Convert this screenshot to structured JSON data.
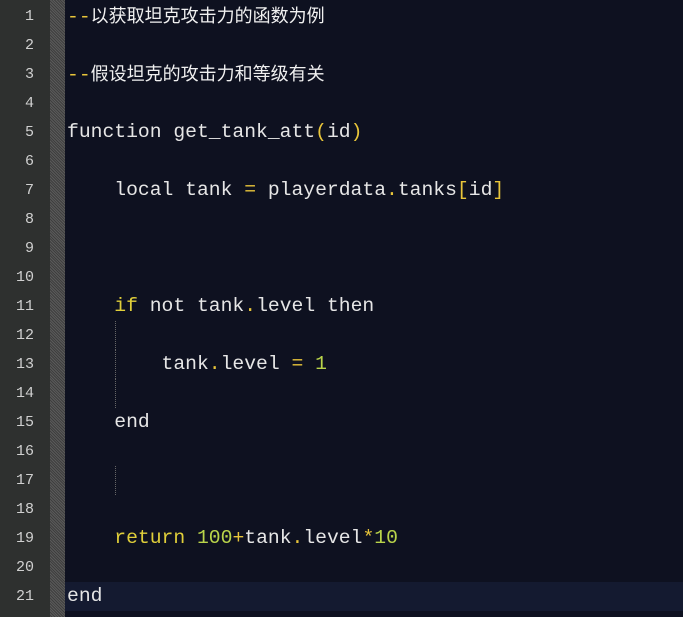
{
  "editor": {
    "colors": {
      "background": "#0e1120",
      "gutter": "#2e302f",
      "comment": "#e8c53a",
      "keyword": "#e0cf3a",
      "number": "#b9d44a",
      "current_line": "#141a30"
    },
    "current_line": 21,
    "lines": [
      {
        "n": "1",
        "tokens": [
          [
            "comment",
            "--"
          ],
          [
            "cjk",
            "以获取坦克攻击力的函数为例"
          ]
        ]
      },
      {
        "n": "2",
        "tokens": []
      },
      {
        "n": "3",
        "tokens": [
          [
            "comment",
            "--"
          ],
          [
            "cjk",
            "假设坦克的攻击力和等级有关"
          ]
        ]
      },
      {
        "n": "4",
        "tokens": []
      },
      {
        "n": "5",
        "tokens": [
          [
            "plain",
            "function get_tank_att"
          ],
          [
            "punc",
            "("
          ],
          [
            "plain",
            "id"
          ],
          [
            "punc",
            ")"
          ]
        ]
      },
      {
        "n": "6",
        "tokens": []
      },
      {
        "n": "7",
        "tokens": [
          [
            "plain",
            "    local tank "
          ],
          [
            "punc",
            "="
          ],
          [
            "plain",
            " playerdata"
          ],
          [
            "punc",
            "."
          ],
          [
            "plain",
            "tanks"
          ],
          [
            "punc",
            "["
          ],
          [
            "plain",
            "id"
          ],
          [
            "punc",
            "]"
          ]
        ]
      },
      {
        "n": "8",
        "tokens": []
      },
      {
        "n": "9",
        "tokens": []
      },
      {
        "n": "10",
        "tokens": []
      },
      {
        "n": "11",
        "tokens": [
          [
            "plain",
            "    "
          ],
          [
            "kw",
            "if"
          ],
          [
            "plain",
            " not tank"
          ],
          [
            "punc",
            "."
          ],
          [
            "plain",
            "level then"
          ]
        ]
      },
      {
        "n": "12",
        "tokens": [],
        "guide": true
      },
      {
        "n": "13",
        "tokens": [
          [
            "plain",
            "        tank"
          ],
          [
            "punc",
            "."
          ],
          [
            "plain",
            "level "
          ],
          [
            "punc",
            "="
          ],
          [
            "plain",
            " "
          ],
          [
            "num",
            "1"
          ]
        ],
        "guide": true
      },
      {
        "n": "14",
        "tokens": [],
        "guide": true
      },
      {
        "n": "15",
        "tokens": [
          [
            "plain",
            "    end"
          ]
        ]
      },
      {
        "n": "16",
        "tokens": []
      },
      {
        "n": "17",
        "tokens": [],
        "guide": true
      },
      {
        "n": "18",
        "tokens": []
      },
      {
        "n": "19",
        "tokens": [
          [
            "plain",
            "    "
          ],
          [
            "kw",
            "return"
          ],
          [
            "plain",
            " "
          ],
          [
            "num",
            "100"
          ],
          [
            "punc",
            "+"
          ],
          [
            "plain",
            "tank"
          ],
          [
            "punc",
            "."
          ],
          [
            "plain",
            "level"
          ],
          [
            "punc",
            "*"
          ],
          [
            "num",
            "10"
          ]
        ]
      },
      {
        "n": "20",
        "tokens": []
      },
      {
        "n": "21",
        "tokens": [
          [
            "plain",
            "end"
          ]
        ]
      }
    ]
  }
}
